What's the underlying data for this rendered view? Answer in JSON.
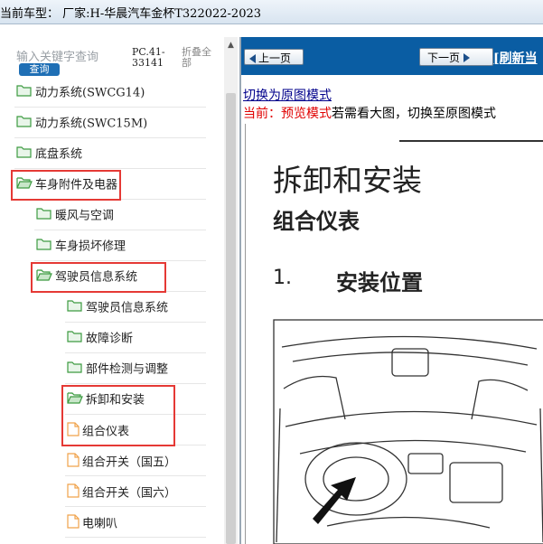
{
  "window": {
    "title": "当前车型： 厂家:H-华晨汽车金杯T322022-2023"
  },
  "sidebar": {
    "search_placeholder": "输入关键字查询",
    "search_button": "查询",
    "code_text": "PC.41-33141",
    "collapse_all": "折叠全部",
    "items": [
      {
        "label": "动力系统(SWCG14)",
        "type": "folder",
        "level": 0,
        "highlight": false
      },
      {
        "label": "动力系统(SWC15M)",
        "type": "folder",
        "level": 0,
        "highlight": false
      },
      {
        "label": "底盘系统",
        "type": "folder",
        "level": 0,
        "highlight": false
      },
      {
        "label": "车身附件及电器",
        "type": "folder-open",
        "level": 0,
        "highlight": true
      },
      {
        "label": "暖风与空调",
        "type": "folder",
        "level": 1,
        "highlight": false
      },
      {
        "label": "车身损坏修理",
        "type": "folder",
        "level": 1,
        "highlight": false
      },
      {
        "label": "驾驶员信息系统",
        "type": "folder-open",
        "level": 1,
        "highlight": true
      },
      {
        "label": "驾驶员信息系统",
        "type": "folder",
        "level": 2,
        "highlight": false
      },
      {
        "label": "故障诊断",
        "type": "folder",
        "level": 2,
        "highlight": false
      },
      {
        "label": "部件检测与调整",
        "type": "folder",
        "level": 2,
        "highlight": false
      },
      {
        "label": "拆卸和安装",
        "type": "folder-open",
        "level": 2,
        "highlight": true
      },
      {
        "label": "组合仪表",
        "type": "file",
        "level": 2,
        "highlight": true
      },
      {
        "label": "组合开关（国五）",
        "type": "file",
        "level": 2,
        "highlight": false
      },
      {
        "label": "组合开关（国六）",
        "type": "file",
        "level": 2,
        "highlight": false
      },
      {
        "label": "电喇叭",
        "type": "file",
        "level": 2,
        "highlight": false
      }
    ]
  },
  "content": {
    "prev_button": "上一页",
    "next_button": "下一页",
    "refresh_link": "[刷新当",
    "switch_link": "切换为原图模式",
    "mode_label": "当前：预览模式",
    "mode_hint": "若需看大图，切换至原图模式",
    "doc": {
      "title": "拆卸和安装",
      "subtitle": "组合仪表",
      "section_number": "1.",
      "section_title": "安装位置"
    }
  },
  "colors": {
    "accent": "#0a5da3",
    "highlight": "#e53935",
    "folder": "#4caf50",
    "file": "#f0a24a"
  }
}
